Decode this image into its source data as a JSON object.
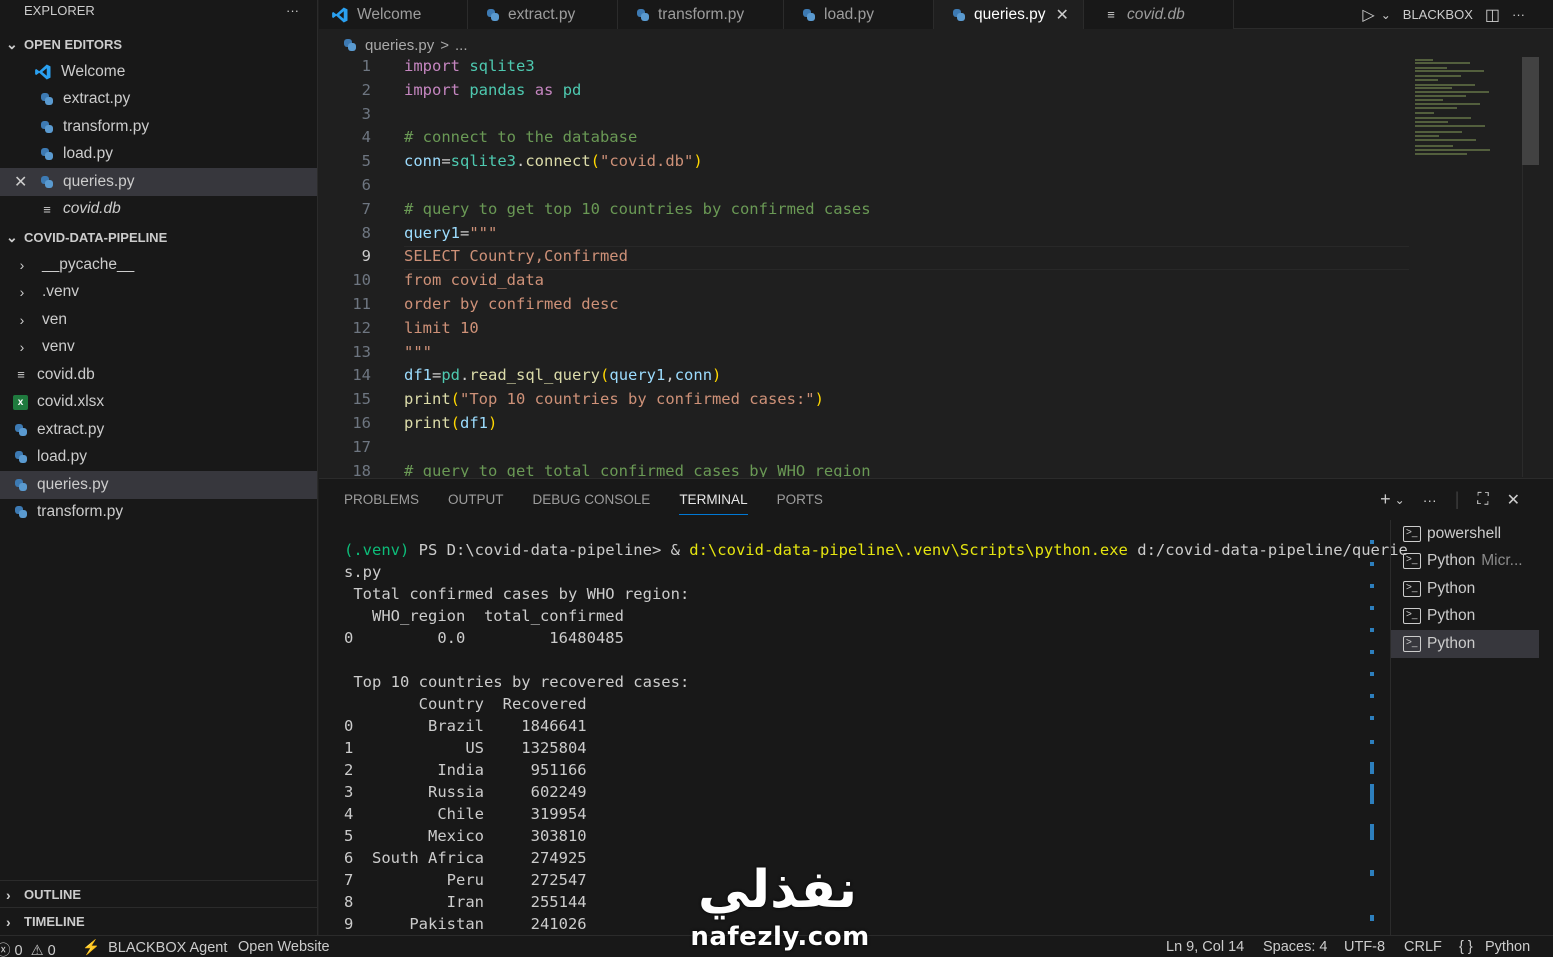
{
  "sidebar": {
    "title": "EXPLORER",
    "more": "···",
    "open_editors": {
      "label": "OPEN EDITORS",
      "items": [
        {
          "label": "Welcome",
          "icon": "vscode-icon"
        },
        {
          "label": "extract.py",
          "icon": "python-icon"
        },
        {
          "label": "transform.py",
          "icon": "python-icon"
        },
        {
          "label": "load.py",
          "icon": "python-icon"
        },
        {
          "label": "queries.py",
          "icon": "python-icon"
        },
        {
          "label": "covid.db",
          "icon": "file-lines-icon"
        }
      ]
    },
    "project": {
      "label": "COVID-DATA-PIPELINE",
      "folders": [
        "__pycache__",
        ".venv",
        "ven",
        "venv"
      ],
      "files": [
        {
          "label": "covid.db",
          "icon": "file-lines-icon"
        },
        {
          "label": "covid.xlsx",
          "icon": "excel-icon"
        },
        {
          "label": "extract.py",
          "icon": "python-icon"
        },
        {
          "label": "load.py",
          "icon": "python-icon"
        },
        {
          "label": "queries.py",
          "icon": "python-icon"
        },
        {
          "label": "transform.py",
          "icon": "python-icon"
        }
      ]
    },
    "outline_label": "OUTLINE",
    "timeline_label": "TIMELINE"
  },
  "tabs": [
    {
      "label": "Welcome"
    },
    {
      "label": "extract.py"
    },
    {
      "label": "transform.py"
    },
    {
      "label": "load.py"
    },
    {
      "label": "queries.py"
    },
    {
      "label": "covid.db"
    }
  ],
  "tab_actions": {
    "blackbox": "BLACKBOX"
  },
  "breadcrumb": {
    "file": "queries.py",
    "sep": ">",
    "more": "..."
  },
  "editor": {
    "line_numbers": [
      "1",
      "2",
      "3",
      "4",
      "5",
      "6",
      "7",
      "8",
      "9",
      "10",
      "11",
      "12",
      "13",
      "14",
      "15",
      "16",
      "17",
      "18"
    ],
    "current_line": "9"
  },
  "panel": {
    "tabs": [
      "PROBLEMS",
      "OUTPUT",
      "DEBUG CONSOLE",
      "TERMINAL",
      "PORTS"
    ],
    "active_tab": "TERMINAL",
    "terminal_lines": [
      "s.py",
      " Total confirmed cases by WHO region:",
      "   WHO_region  total_confirmed",
      "0         0.0         16480485",
      "",
      " Top 10 countries by recovered cases:",
      "        Country  Recovered",
      "0        Brazil    1846641",
      "1            US    1325804",
      "2         India     951166",
      "3        Russia     602249",
      "4         Chile     319954",
      "5        Mexico     303810",
      "6  South Africa     274925",
      "7          Peru     272547",
      "8          Iran     255144",
      "9      Pakistan     241026"
    ],
    "prompt": {
      "venv": "(.venv)",
      "ps": " PS D:\\covid-data-pipeline> ",
      "amp": "& ",
      "exe": "d:\\covid-data-pipeline\\.venv\\Scripts\\python.exe",
      "arg": " d:/covid-data-pipeline/querie"
    },
    "terminals": [
      {
        "label": "powershell",
        "extra": ""
      },
      {
        "label": "Python",
        "extra": "Micr..."
      },
      {
        "label": "Python",
        "extra": ""
      },
      {
        "label": "Python",
        "extra": ""
      },
      {
        "label": "Python",
        "extra": ""
      }
    ]
  },
  "status": {
    "errors": "0",
    "warnings": "0",
    "agent": "BLACKBOX Agent",
    "website": "Open Website",
    "position": "Ln 9, Col 14",
    "spaces": "Spaces: 4",
    "encoding": "UTF-8",
    "eol": "CRLF",
    "language": "Python",
    "braces": "{ }"
  },
  "watermark": {
    "arabic": "نفذلي",
    "latin": "nafezly.com"
  },
  "colors": {
    "accent": "#0078d4",
    "background": "#1f1f1f",
    "sidebar": "#181818"
  }
}
